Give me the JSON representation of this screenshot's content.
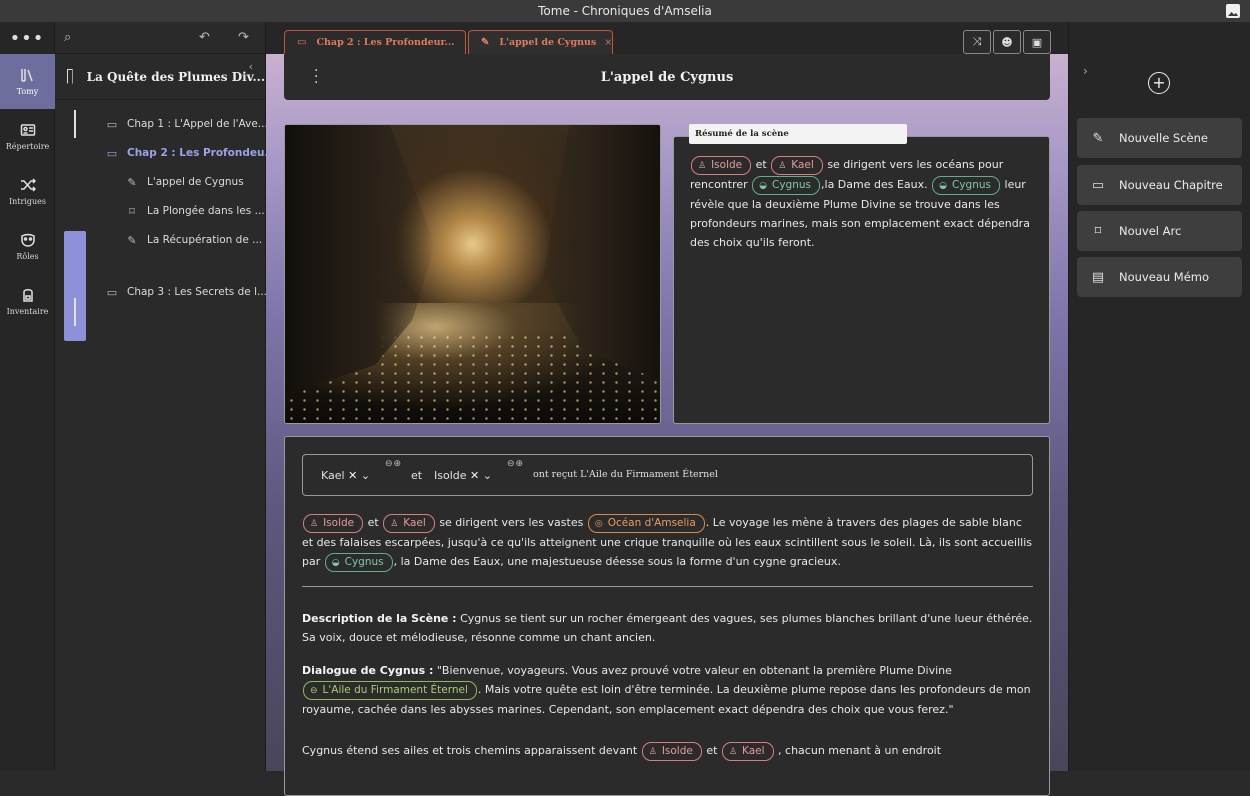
{
  "window": {
    "title": "Tome - Chroniques d'Amselia"
  },
  "rail": {
    "menu": "•••",
    "items": [
      {
        "label": "Tomy",
        "icon": "books-icon"
      },
      {
        "label": "Répertoire",
        "icon": "contact-card-icon"
      },
      {
        "label": "Intrigues",
        "icon": "shuffle-icon"
      },
      {
        "label": "Rôles",
        "icon": "mask-icon"
      },
      {
        "label": "Inventaire",
        "icon": "backpack-icon"
      }
    ]
  },
  "tree": {
    "book_title": "La Quête des Plumes Div...",
    "items": [
      {
        "label": "Chap 1 : L'Appel de l'Ave...",
        "type": "chapter"
      },
      {
        "label": "Chap 2 : Les Profondeu...",
        "type": "chapter"
      },
      {
        "label": "L'appel de Cygnus",
        "type": "scene"
      },
      {
        "label": "La Plongée dans les ...",
        "type": "arc"
      },
      {
        "label": "La Récupération de ...",
        "type": "scene"
      },
      {
        "label": "Chap 3 : Les Secrets de l...",
        "type": "chapter"
      }
    ]
  },
  "tabs": [
    {
      "label": "Chap 2 : Les Profondeur...",
      "icon": "chapter-icon"
    },
    {
      "label": "L'appel de Cygnus",
      "icon": "feather-icon",
      "close": "×"
    }
  ],
  "scene": {
    "title": "L'appel de Cygnus"
  },
  "summary": {
    "label": "Résumé de la scène",
    "chips": {
      "isolde": "Isolde",
      "kael": "Kael",
      "cygnus": "Cygnus"
    },
    "t1": "et",
    "t2": "se dirigent vers les océans pour rencontrer",
    "t3": ",la Dame des Eaux.",
    "t4": "leur révèle que la deuxième Plume Divine se trouve dans les profondeurs marines, mais son emplacement exact dépendra des choix qu'ils feront."
  },
  "receipt": {
    "who1": "Kael",
    "who2": "Isolde",
    "pm": "⊖⊕",
    "and": "et",
    "text": "ont reçut L'Aile du Firmament Éternel"
  },
  "body": {
    "chips": {
      "isolde": "Isolde",
      "kael": "Kael",
      "ocean": "Océan d'Amselia",
      "cygnus": "Cygnus",
      "aile": "L'Aile du Firmament Éternel"
    },
    "p1a": "et",
    "p1b": "se dirigent vers les vastes",
    "p1c": ". Le voyage les mène à travers des plages de sable blanc et des falaises escarpées, jusqu'à ce qu'ils atteignent une crique tranquille où les eaux scintillent sous le soleil. Là, ils sont accueillis par",
    "p1d": ", la Dame des Eaux, une majestueuse déesse sous la forme d'un cygne gracieux.",
    "desc_label": "Description de la Scène :",
    "desc_text": "Cygnus se tient sur un rocher émergeant des vagues, ses plumes blanches brillant d'une lueur éthérée. Sa voix, douce et mélodieuse, résonne comme un chant ancien.",
    "dial_label": "Dialogue de Cygnus :",
    "dial_a": "\"Bienvenue, voyageurs. Vous avez prouvé votre valeur en obtenant la première Plume Divine",
    "dial_b": ". Mais votre quête est loin d'être terminée. La deuxième plume repose dans les profondeurs de mon royaume, cachée dans les abysses marines. Cependant, son emplacement exact dépendra des choix que vous ferez.\"",
    "p4a": "Cygnus étend ses ailes et trois chemins apparaissent devant",
    "p4b": "et",
    "p4c": ", chacun menant à un endroit"
  },
  "right": {
    "plus": "+",
    "buttons": [
      {
        "label": "Nouvelle Scène",
        "icon": "feather-icon"
      },
      {
        "label": "Nouveau Chapitre",
        "icon": "scroll-icon"
      },
      {
        "label": "Nouvel Arc",
        "icon": "bookmark-icon"
      },
      {
        "label": "Nouveau Mémo",
        "icon": "memo-card-icon"
      }
    ]
  }
}
